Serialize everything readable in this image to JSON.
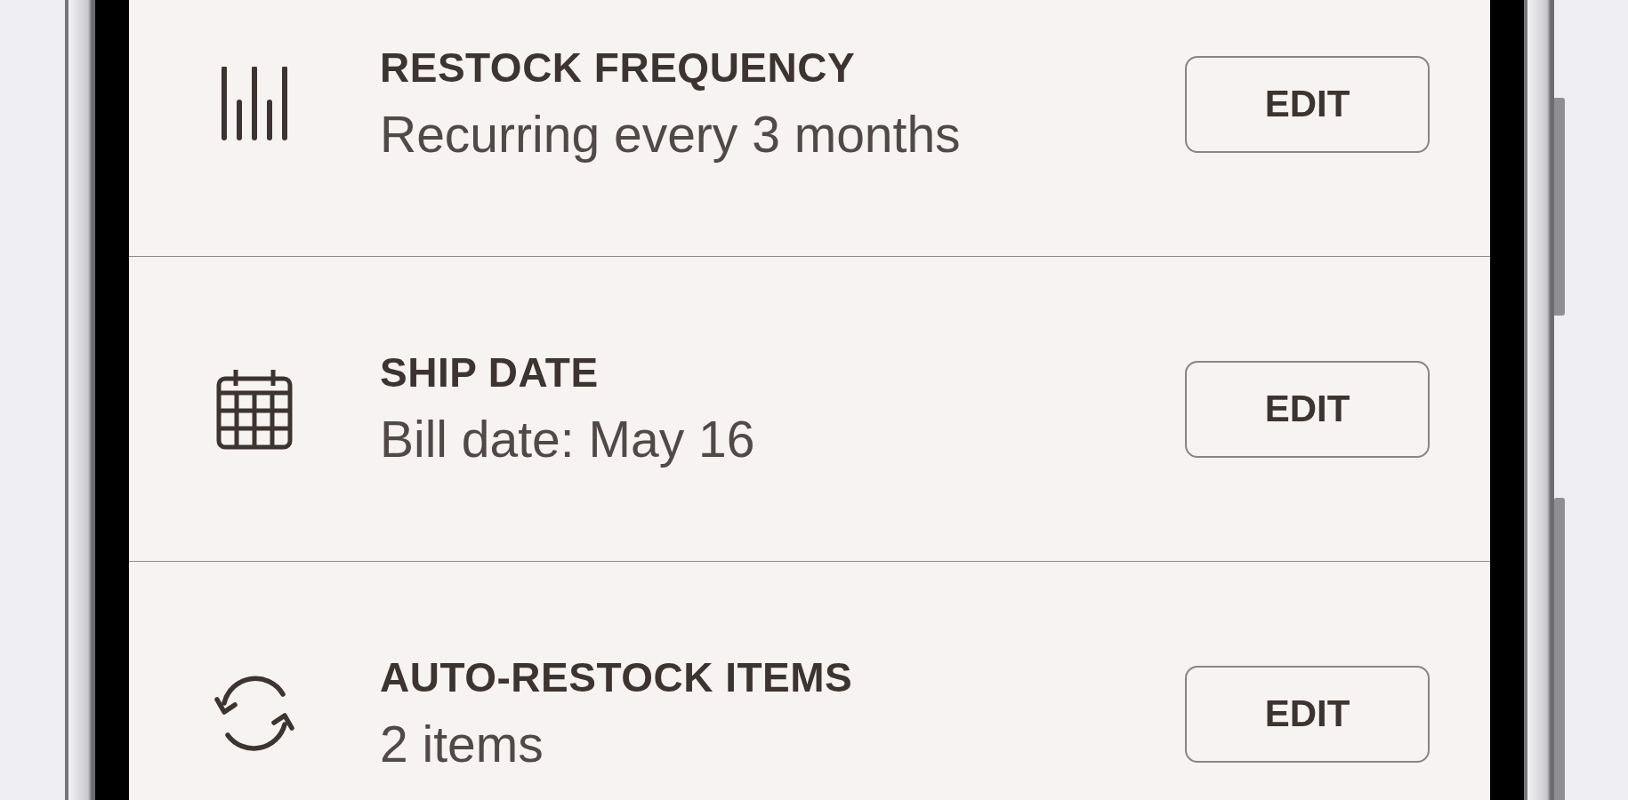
{
  "settings": [
    {
      "kind": "frequency",
      "title": "RESTOCK FREQUENCY",
      "value": "Recurring every 3 months",
      "button": "EDIT"
    },
    {
      "kind": "date",
      "title": "SHIP DATE",
      "value": "Bill date: May 16",
      "button": "EDIT"
    },
    {
      "kind": "items",
      "title": "AUTO-RESTOCK ITEMS",
      "value": "2 items",
      "button": "EDIT"
    }
  ]
}
